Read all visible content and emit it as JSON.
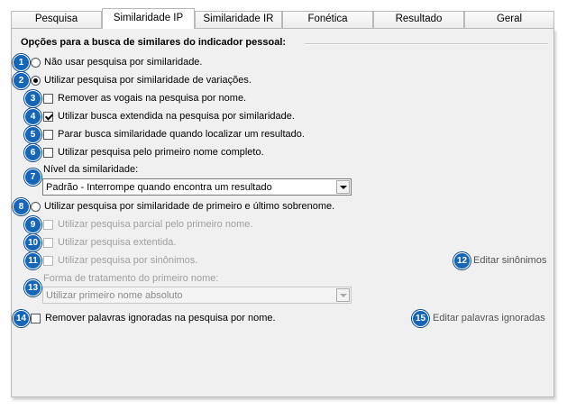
{
  "tabs": [
    {
      "label": "Pesquisa"
    },
    {
      "label": "Similaridade IP"
    },
    {
      "label": "Similaridade IR"
    },
    {
      "label": "Fonética"
    },
    {
      "label": "Resultado"
    },
    {
      "label": "Geral"
    }
  ],
  "active_tab": "Similaridade IP",
  "section_title": "Opções para a busca de similares do indicador pessoal:",
  "options": {
    "no_similarity": {
      "badge": "1",
      "label": "Não usar pesquisa por similaridade.",
      "checked": false
    },
    "variations": {
      "badge": "2",
      "label": "Utilizar pesquisa por similaridade de variações.",
      "checked": true
    },
    "remove_vowels": {
      "badge": "3",
      "label": "Remover as vogais na pesquisa por nome.",
      "checked": false
    },
    "extended_search": {
      "badge": "4",
      "label": "Utilizar busca extendida na pesquisa por similaridade.",
      "checked": true
    },
    "stop_on_result": {
      "badge": "5",
      "label": "Parar busca similaridade quando localizar um resultado.",
      "checked": false
    },
    "first_name_full": {
      "badge": "6",
      "label": "Utilizar pesquisa pelo primeiro nome completo.",
      "checked": false
    },
    "similarity_level": {
      "badge": "7",
      "label": "Nível da similaridade:",
      "value": "Padrão - Interrompe quando encontra um resultado"
    },
    "first_last": {
      "badge": "8",
      "label": "Utilizar pesquisa por similaridade de primeiro e último sobrenome.",
      "checked": false
    },
    "partial_first": {
      "badge": "9",
      "label": "Utilizar pesquisa parcial pelo primeiro nome.",
      "checked": false
    },
    "extended": {
      "badge": "10",
      "label": "Utilizar pesquisa extentida.",
      "checked": false
    },
    "synonyms": {
      "badge": "11",
      "label": "Utilizar pesquisa por sinônimos.",
      "checked": false
    },
    "edit_synonyms": {
      "badge": "12",
      "label": "Editar sinônimos"
    },
    "treatment": {
      "badge": "13",
      "label": "Forma de tratamento do primeiro nome:",
      "value": "Utilizar primeiro nome absoluto"
    },
    "remove_ignored": {
      "badge": "14",
      "label": "Remover palavras ignoradas na pesquisa por nome.",
      "checked": false
    },
    "edit_ignored": {
      "badge": "15",
      "label": "Editar palavras ignoradas"
    }
  },
  "colors": {
    "badge": "#1565b8",
    "panel": "#f0f0f0",
    "disabled_text": "#a0a0a0"
  }
}
